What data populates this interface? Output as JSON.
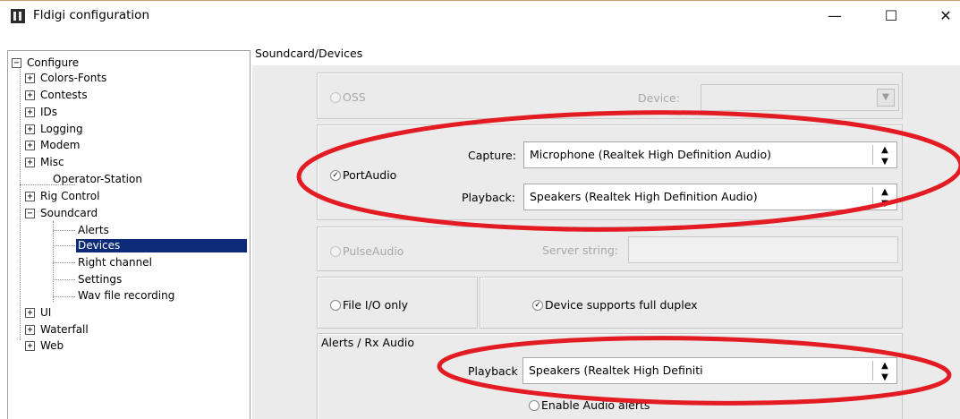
{
  "window": {
    "title": "Fldigi configuration",
    "controls": {
      "minimize": "—",
      "maximize": "☐",
      "close": "✕"
    }
  },
  "tree": {
    "items": [
      {
        "label": "Configure",
        "toggle": "−"
      },
      {
        "label": "Colors-Fonts",
        "toggle": "+"
      },
      {
        "label": "Contests",
        "toggle": "+"
      },
      {
        "label": "IDs",
        "toggle": "+"
      },
      {
        "label": "Logging",
        "toggle": "+"
      },
      {
        "label": "Modem",
        "toggle": "+"
      },
      {
        "label": "Misc",
        "toggle": "+"
      },
      {
        "label": "Operator-Station",
        "toggle": ""
      },
      {
        "label": "Rig Control",
        "toggle": "+"
      },
      {
        "label": "Soundcard",
        "toggle": "−"
      },
      {
        "label": "Alerts",
        "toggle": ""
      },
      {
        "label": "Devices",
        "toggle": ""
      },
      {
        "label": "Right channel",
        "toggle": ""
      },
      {
        "label": "Settings",
        "toggle": ""
      },
      {
        "label": "Wav file recording",
        "toggle": ""
      },
      {
        "label": "UI",
        "toggle": "+"
      },
      {
        "label": "Waterfall",
        "toggle": "+"
      },
      {
        "label": "Web",
        "toggle": "+"
      }
    ],
    "selected": "Devices"
  },
  "section": {
    "title": "Soundcard/Devices"
  },
  "oss": {
    "label": "OSS",
    "device_label": "Device:",
    "device_value": "",
    "arrow": "▼"
  },
  "portaudio": {
    "label": "PortAudio",
    "checked_mark": "✓",
    "capture_label": "Capture:",
    "capture_value": "Microphone (Realtek High Definition Audio)",
    "playback_label": "Playback:",
    "playback_value": "Speakers (Realtek High Definition Audio)"
  },
  "pulseaudio": {
    "label": "PulseAudio",
    "server_label": "Server string:",
    "server_value": ""
  },
  "fileio": {
    "label": "File I/O only",
    "duplex_label": "Device supports full duplex",
    "duplex_mark": "✓"
  },
  "alerts": {
    "title": "Alerts / Rx Audio",
    "playback_label": "Playback",
    "playback_value": "Speakers (Realtek High Definiti",
    "enable_label": "Enable Audio alerts"
  },
  "colors": {
    "annotation": "#e31b23",
    "selection": "#0c2a78"
  }
}
